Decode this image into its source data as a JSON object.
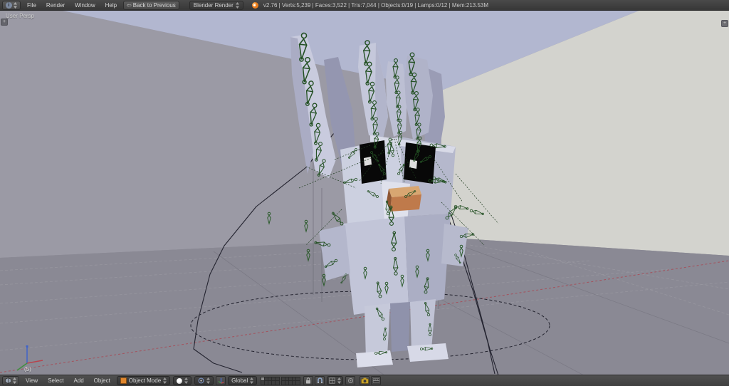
{
  "header": {
    "menus": [
      {
        "label": "File"
      },
      {
        "label": "Render"
      },
      {
        "label": "Window"
      },
      {
        "label": "Help"
      }
    ],
    "back_button_label": "Back to Previous",
    "render_engine": "Blender Render",
    "stats": "v2.76 | Verts:5,239 | Faces:3,522 | Tris:7,044 | Objects:0/19 | Lamps:0/12 | Mem:213.53M"
  },
  "viewport": {
    "view_mode_label": "User Persp",
    "frame_indicator": "(5)",
    "expander_glyph": "+",
    "colors": {
      "floor": "#8a8994",
      "wall_left": "#9b9aa5",
      "wall_back": "#b2b7d0",
      "wall_right": "#d3d3ce",
      "character_body": "#c6c8da",
      "armature_bone": "#235023",
      "curve_line": "#23232f",
      "x_axis_red": "#a4515c",
      "eye_black": "#080808",
      "mouth_orange": "#bf7a4b",
      "gizmo_x": "#b8434c",
      "gizmo_y": "#3f8f3f",
      "gizmo_z": "#3f63c8"
    }
  },
  "footer": {
    "menus": [
      {
        "label": "View"
      },
      {
        "label": "Select"
      },
      {
        "label": "Add"
      },
      {
        "label": "Object"
      }
    ],
    "mode_select": "Object Mode",
    "orientation_select": "Global"
  },
  "icons": {
    "editor_info": "info-icon",
    "back": "back-arrow-icon",
    "blender_logo": "blender-logo-icon",
    "editor_3d_view": "3d-view-icon",
    "object_mode": "object-mode-cube-icon",
    "viewport_shading": "shading-sphere-icon",
    "pivot_point": "pivot-point-icon",
    "manipulator": "manipulator-axes-icon",
    "lock": "lock-icon",
    "snap": "magnet-icon",
    "snap_element": "snap-element-icon",
    "render_still": "camera-icon",
    "render_anim": "film-icon",
    "dropdown": "chevron-updown-icon"
  }
}
